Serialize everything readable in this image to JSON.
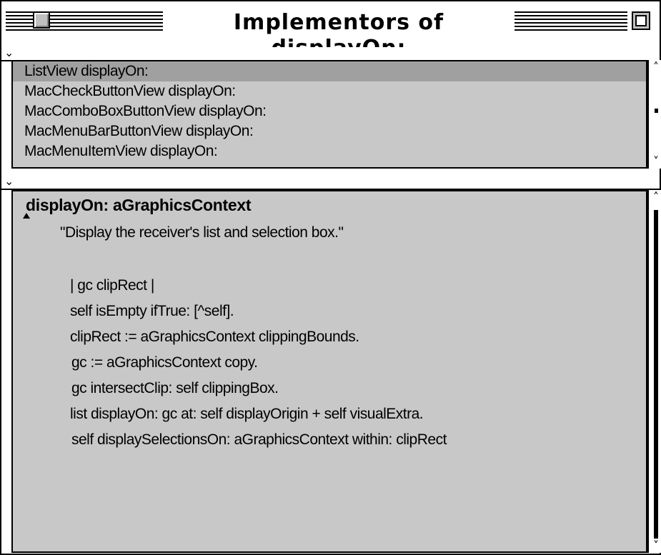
{
  "window": {
    "title": "Implementors of displayOn:"
  },
  "list_pane": {
    "menu_glyph": "⌄",
    "items": [
      {
        "label": "ListView displayOn:",
        "selected": true
      },
      {
        "label": "MacCheckButtonView displayOn:",
        "selected": false
      },
      {
        "label": "MacComboBoxButtonView displayOn:",
        "selected": false
      },
      {
        "label": "MacMenuBarButtonView displayOn:",
        "selected": false
      },
      {
        "label": "MacMenuItemView displayOn:",
        "selected": false
      }
    ]
  },
  "code_pane": {
    "menu_glyph": "⌄",
    "signature": "displayOn: aGraphicsContext",
    "lines": [
      "\"Display the receiver's list and selection box.\"",
      "",
      "| gc clipRect |",
      "self isEmpty ifTrue: [^self].",
      "clipRect := aGraphicsContext clippingBounds.",
      "gc := aGraphicsContext copy.",
      "gc intersectClip: self clippingBox.",
      "list displayOn: gc at: self displayOrigin + self visualExtra.",
      "self displaySelectionsOn: aGraphicsContext within: clipRect"
    ]
  },
  "scroll": {
    "up_arrow": "˄",
    "down_arrow": "˅"
  },
  "colors": {
    "pane_background": "#c8c8c8",
    "selection": "#a0a0a0"
  }
}
